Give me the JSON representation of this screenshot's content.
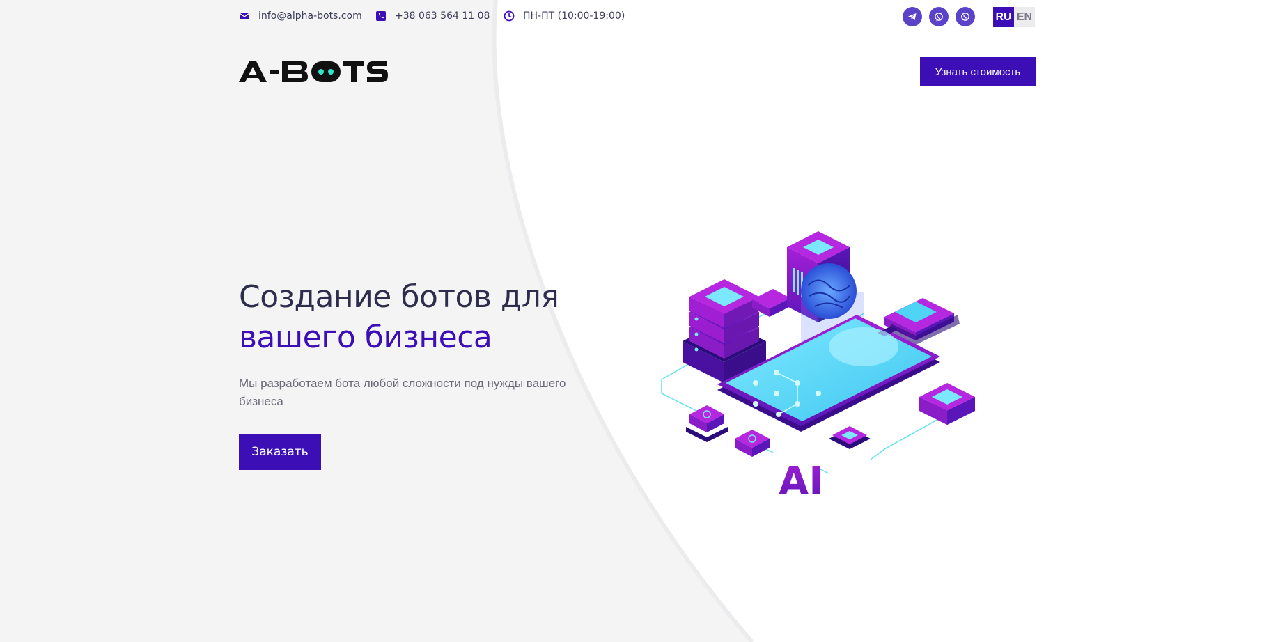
{
  "contacts": {
    "email": "info@alpha-bots.com",
    "phone": "+38 063 564 11 08",
    "hours": "ПН-ПТ (10:00-19:00)"
  },
  "socials": [
    {
      "name": "telegram",
      "icon": "telegram-icon"
    },
    {
      "name": "viber",
      "icon": "viber-icon"
    },
    {
      "name": "whatsapp",
      "icon": "whatsapp-icon"
    }
  ],
  "language": {
    "options": [
      "RU",
      "EN"
    ],
    "selected": "RU"
  },
  "header": {
    "logo_text": "A-BOTS",
    "cta_label": "Узнать стоимость"
  },
  "hero": {
    "title_line1": "Создание ботов для",
    "title_line2": "вашего бизнеса",
    "subtitle": "Мы разработаем бота любой сложности под нужды вашего бизнеса",
    "button_label": "Заказать"
  },
  "illustration": {
    "badge_text": "AI"
  },
  "colors": {
    "accent": "#3b0fb5",
    "social_bg": "#5b43c9",
    "title": "#2e2d4d",
    "text": "#6a6a78",
    "background": "#f4f4f5"
  }
}
